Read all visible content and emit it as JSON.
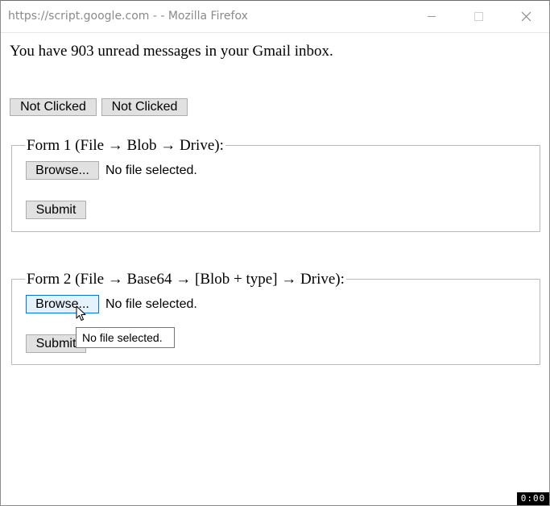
{
  "window": {
    "title": "https://script.google.com - - Mozilla Firefox"
  },
  "page": {
    "message": "You have 903 unread messages in your Gmail inbox.",
    "buttons": [
      {
        "label": "Not Clicked"
      },
      {
        "label": "Not Clicked"
      }
    ],
    "forms": [
      {
        "legend": "Form 1 (File → Blob → Drive):",
        "browse_label": "Browse...",
        "file_status": "No file selected.",
        "submit_label": "Submit"
      },
      {
        "legend": "Form 2 (File → Base64 → [Blob + type] → Drive):",
        "browse_label": "Browse...",
        "file_status": "No file selected.",
        "submit_label": "Submit"
      }
    ],
    "tooltip": "No file selected."
  },
  "recorder": {
    "timer": "0:00"
  },
  "icons": {
    "minimize": "minimize-icon",
    "maximize": "maximize-icon",
    "close": "close-icon",
    "cursor": "mouse-pointer-icon"
  }
}
